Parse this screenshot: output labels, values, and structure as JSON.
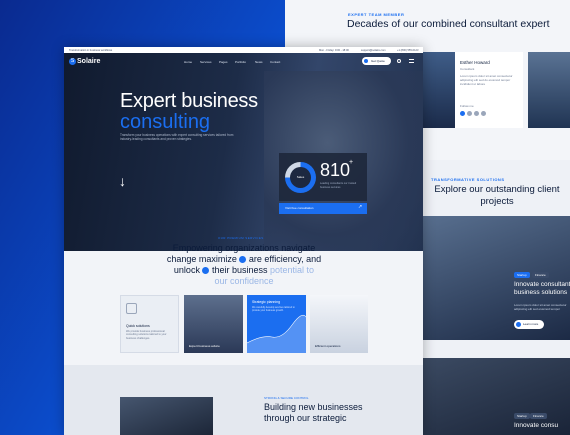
{
  "right_top": {
    "eyebrow": "EXPERT TEAM MEMBER",
    "title": "Decades of our combined consultant expert",
    "member_name": "Esther Howard",
    "member_role": "Consultant",
    "member_bio": "Lorem ipsum dolor sit amet consectetur adipiscing elit sed do eiusmod tempor incididunt ut labore",
    "follow_label": "Follow me"
  },
  "right_projects": {
    "eyebrow": "TRANSFORMATIVE SOLUTIONS",
    "title": "Explore our outstanding client projects",
    "tag1": "Startup",
    "tag2": "Finance",
    "proj1_title": "Innovate consultant business solutions",
    "proj1_desc": "Lorem ipsum dolor sit amet consectetur adipiscing elit sed eiusmod tempor",
    "learn_more": "Learn more",
    "tag3": "Startup",
    "tag4": "Finance",
    "proj2_title": "Innovate consu"
  },
  "topbar": {
    "left": "Transformation in business workflows",
    "hours": "Mon - Friday: 9:00 - 18:00",
    "email": "support@solaire.com",
    "phone": "+1 (800) 555-0123"
  },
  "nav": {
    "logo": "Solaire",
    "items": [
      "Home",
      "Services",
      "Pages",
      "Portfolio",
      "News",
      "Contact"
    ],
    "cta": "Get Quote"
  },
  "hero": {
    "title_line1": "Expert business",
    "title_line2": "consulting",
    "desc": "Transform your business operations with expert consulting services tailored from industry-leading consultants and proven strategies.",
    "stat_ring_label": "Sales",
    "stat_number": "810",
    "stat_suffix": "+",
    "stat_desc": "Leading consultants our trusted business services",
    "visit_label": "Visit free consultation"
  },
  "intro": {
    "eyebrow": "OUR PREMIUM SERVICES",
    "line1": "Empowering organizations navigate",
    "line2a": "change maximize",
    "line2b": "are efficiency, and",
    "line3a": "unlock",
    "line3b": "their business",
    "line3c": "potential to",
    "line4": "our confidence"
  },
  "features": {
    "card1_title": "Quick solutions",
    "card1_desc": "We provide business professional consulting solutions tailored to your business challenges.",
    "card2_label": "Expert business advice",
    "card3_title": "Strategic planning",
    "card3_desc": "We carefully develop services tailored to provide your business growth.",
    "card4_label": "Efficient operations"
  },
  "bottom": {
    "eyebrow": "STRONG & SECURE CONTROL",
    "title": "Building new businesses through our strategic"
  }
}
